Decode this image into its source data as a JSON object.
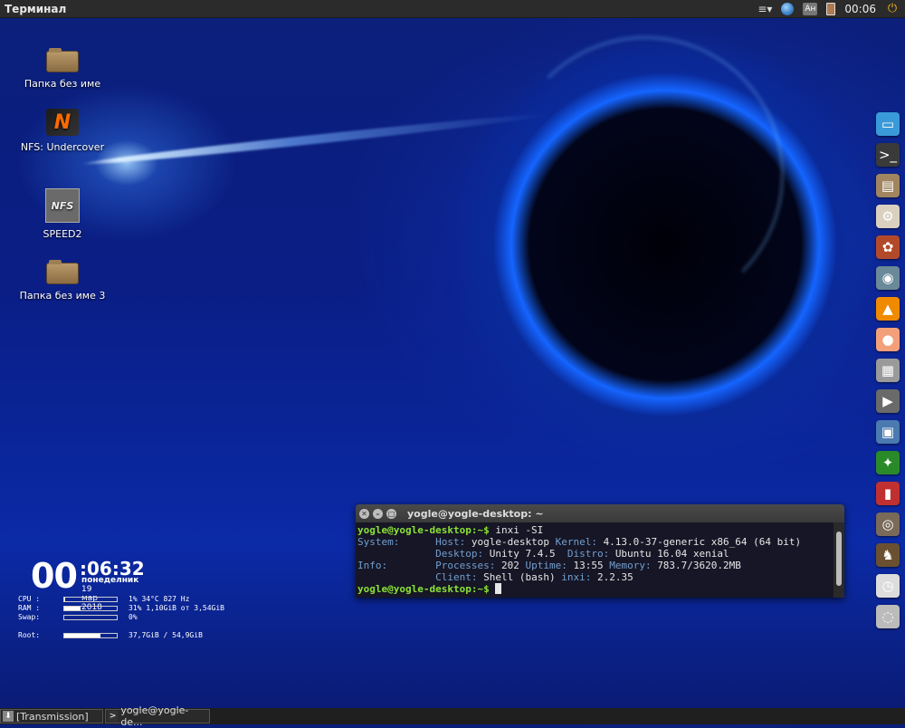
{
  "topbar": {
    "title": "Терминал",
    "menu_icon": "≡▾",
    "lang": "Ан",
    "clock": "00:06"
  },
  "desktop_icons": [
    {
      "label": "Папка без име",
      "icon": "folder-icon"
    },
    {
      "label": "NFS: Undercover",
      "icon": "nfs-icon"
    },
    {
      "label": "SPEED2",
      "icon": "speed2-icon"
    },
    {
      "label": "Папка без име 3",
      "icon": "folder-icon"
    }
  ],
  "speed_logo_text": "NFS",
  "nfs_logo_text": "N",
  "conky": {
    "hours": "00",
    "time_rest": ":06:32",
    "weekday": "понеделник",
    "date": "19 мар 2018",
    "cpu_label": "CPU :",
    "cpu_value": "1%  34°C 827 Hz",
    "cpu_fraction": 0.01,
    "ram_label": "RAM :",
    "ram_value": "31% 1,10GiB от 3,54GiB",
    "ram_fraction": 0.31,
    "swap_label": "Swap:",
    "swap_value": "0%",
    "swap_fraction": 0.0,
    "root_label": "Root:",
    "root_value": "37,7GiB / 54,9GiB",
    "root_fraction": 0.69
  },
  "terminal": {
    "title": "yogle@yogle-desktop: ~",
    "prompt": "yogle@yogle-desktop:~$",
    "command": " inxi -SI",
    "lines": [
      {
        "key": "System:",
        "content": "Host: yogle-desktop Kernel: 4.13.0-37-generic x86_64 (64 bit)"
      },
      {
        "key": "",
        "content": "Desktop: Unity 7.4.5  Distro: Ubuntu 16.04 xenial"
      },
      {
        "key": "Info:",
        "content": "Processes: 202 Uptime: 13:55 Memory: 783.7/3620.2MB"
      },
      {
        "key": "",
        "content": "Client: Shell (bash) inxi: 2.2.35"
      }
    ],
    "prompt2": "yogle@yogle-desktop:~$"
  },
  "taskbar": {
    "items": [
      {
        "label": "[Transmission]"
      },
      {
        "label": "yogle@yogle-de..."
      }
    ]
  },
  "dock_items": [
    {
      "name": "dock-files-icon",
      "color": "#3a9ad9"
    },
    {
      "name": "dock-terminal-icon",
      "color": "#3a3a3a"
    },
    {
      "name": "dock-archive-icon",
      "color": "#a08560"
    },
    {
      "name": "dock-settings-icon",
      "color": "#d9d0c0"
    },
    {
      "name": "dock-gnome-icon",
      "color": "#b24a2a"
    },
    {
      "name": "dock-network-icon",
      "color": "#6a8a9a"
    },
    {
      "name": "dock-vlc-icon",
      "color": "#f08a00"
    },
    {
      "name": "dock-peach-icon",
      "color": "#f3a07a"
    },
    {
      "name": "dock-calculator-icon",
      "color": "#9a9a9a"
    },
    {
      "name": "dock-video-icon",
      "color": "#6a6a6a"
    },
    {
      "name": "dock-images-icon",
      "color": "#4a7ab0"
    },
    {
      "name": "dock-solitaire-icon",
      "color": "#2a8a2a"
    },
    {
      "name": "dock-pencils-icon",
      "color": "#c03030"
    },
    {
      "name": "dock-film-icon",
      "color": "#7a6a5a"
    },
    {
      "name": "dock-chess-icon",
      "color": "#6a5030"
    },
    {
      "name": "dock-clock-icon",
      "color": "#dddddd"
    },
    {
      "name": "dock-satellite-icon",
      "color": "#bbbbbb"
    }
  ]
}
